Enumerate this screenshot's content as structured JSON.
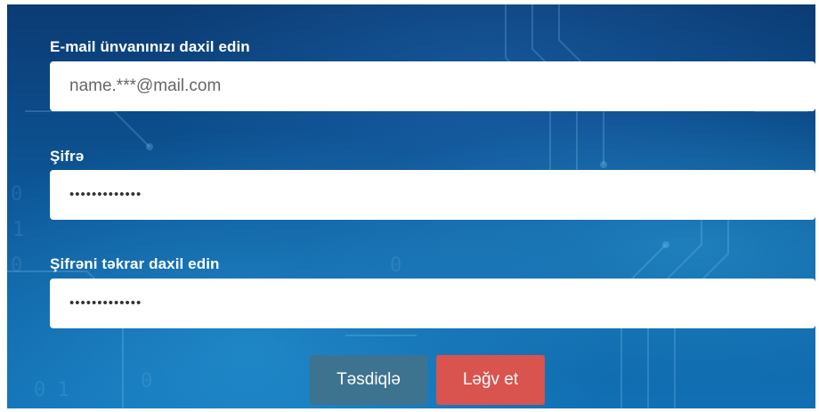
{
  "form": {
    "email": {
      "label": "E-mail ünvanınızı daxil edin",
      "placeholder": "name.***@mail.com",
      "value": ""
    },
    "password": {
      "label": "Şifrə",
      "value": "•••••••••••••"
    },
    "password_repeat": {
      "label": "Şifrəni təkrar daxil edin",
      "value": "•••••••••••••"
    }
  },
  "actions": {
    "confirm_label": "Təsdiqlə",
    "cancel_label": "Ləğv et"
  },
  "colors": {
    "confirm_button": "#3e7390",
    "cancel_button": "#d9534f"
  }
}
